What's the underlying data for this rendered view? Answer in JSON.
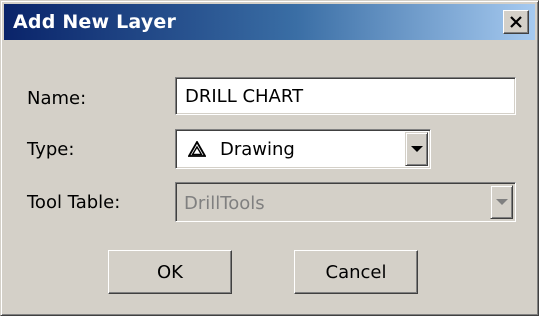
{
  "window": {
    "title": "Add New Layer",
    "close_icon": "close-x-icon"
  },
  "form": {
    "name_label": "Name:",
    "name_value": "DRILL CHART",
    "type_label": "Type:",
    "type_icon": "drawing-triangle-icon",
    "type_value": "Drawing",
    "tool_table_label": "Tool Table:",
    "tool_table_value": "DrillTools",
    "tool_table_enabled": false
  },
  "buttons": {
    "ok_label": "OK",
    "cancel_label": "Cancel"
  },
  "colors": {
    "title_bar_start": "#0a246a",
    "title_bar_end": "#a6caf0",
    "face": "#d4d0c8",
    "disabled_text": "#808080"
  }
}
